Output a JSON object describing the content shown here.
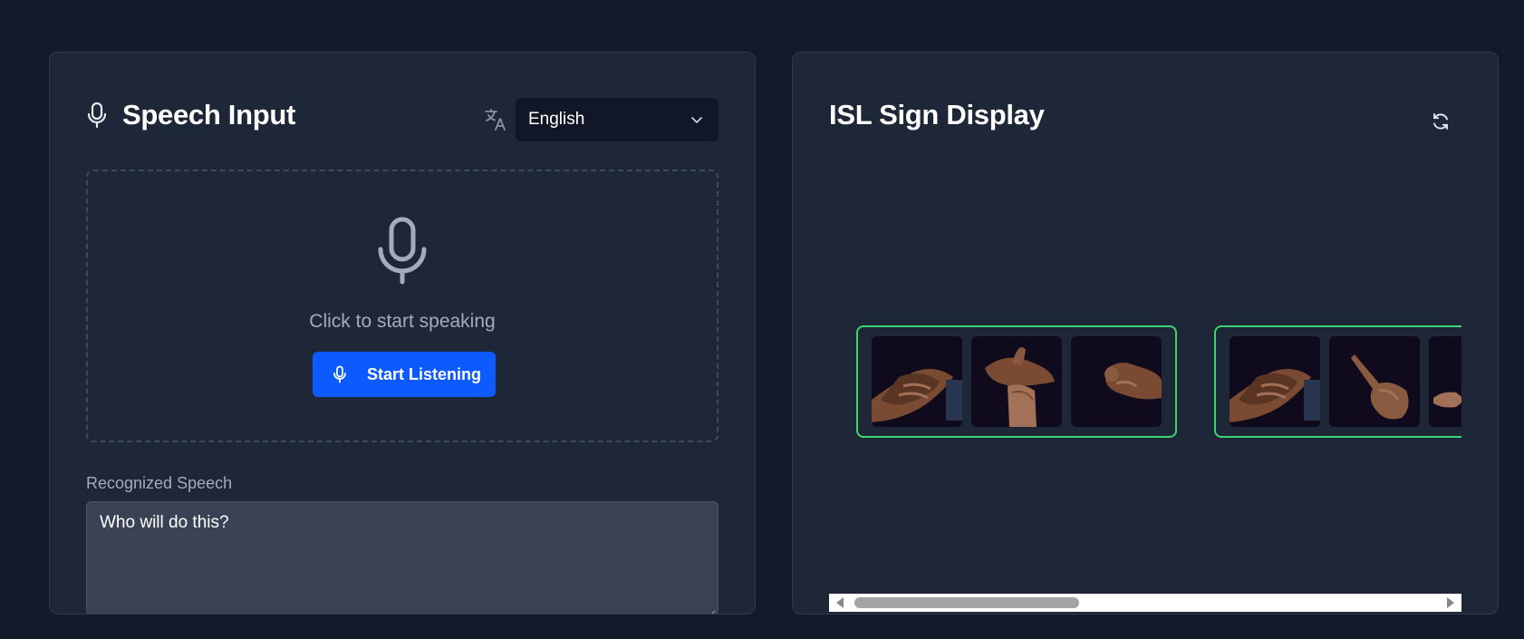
{
  "speech_panel": {
    "title": "Speech Input",
    "title_icon": "microphone-icon",
    "translate_icon": "translate-icon",
    "language_select": {
      "selected": "English",
      "icon": "chevron-down-icon"
    },
    "dropzone": {
      "icon": "microphone-icon",
      "prompt": "Click to start speaking",
      "button_label": "Start Listening",
      "button_icon": "microphone-icon"
    },
    "recognized": {
      "label": "Recognized Speech",
      "value": "Who will do this?"
    }
  },
  "sign_panel": {
    "title": "ISL Sign Display",
    "refresh_icon": "refresh-icon",
    "word_groups": [
      {
        "signs": [
          "hand-sign-image",
          "hand-sign-image",
          "hand-sign-image"
        ]
      },
      {
        "signs": [
          "hand-sign-image",
          "hand-sign-image",
          "hand-sign-image"
        ]
      }
    ]
  },
  "colors": {
    "background": "#131a29",
    "panel": "#1e2738",
    "accent": "#0d5bff",
    "group_border": "#3dd46e",
    "input_bg": "#3a4355"
  }
}
